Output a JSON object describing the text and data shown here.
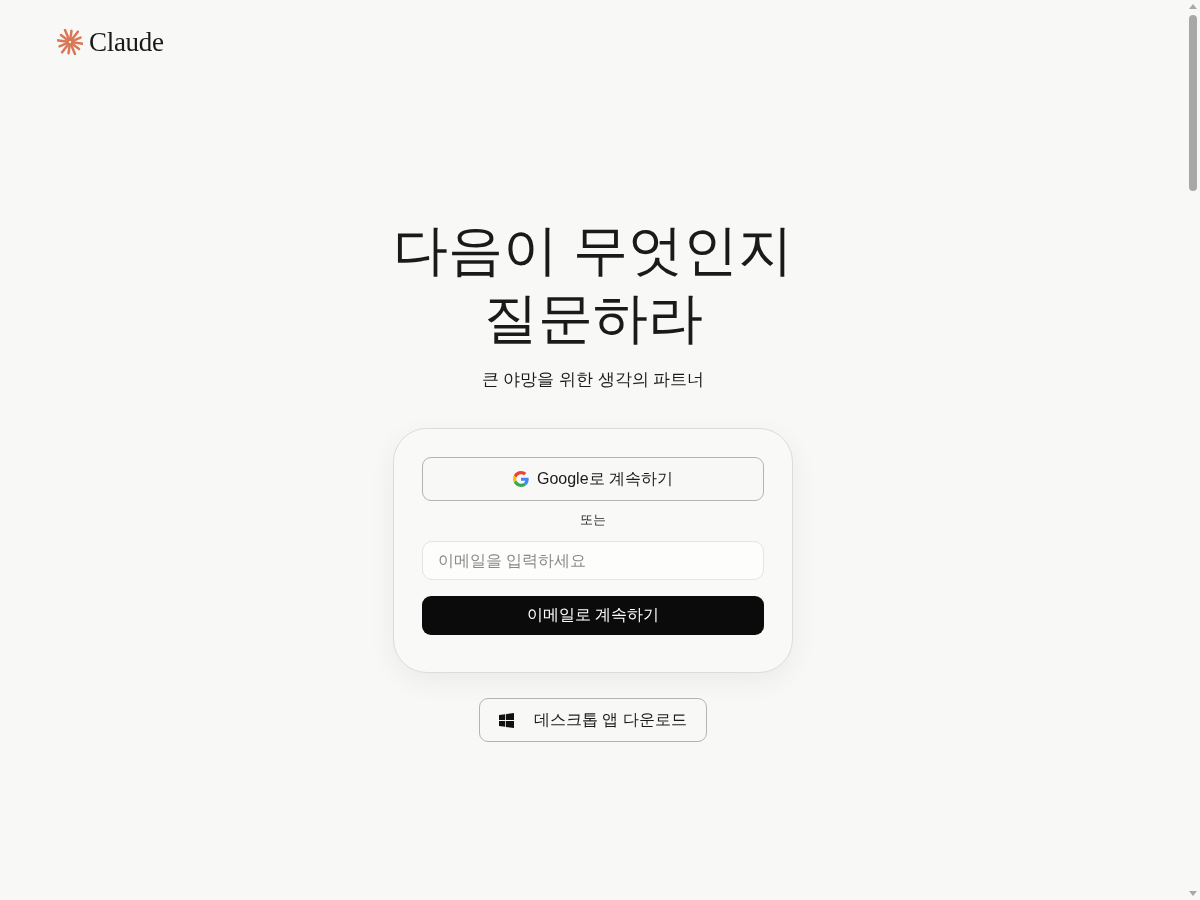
{
  "header": {
    "logo_text": "Claude"
  },
  "hero": {
    "title_lines": [
      "다음이 무엇인지",
      "질문하라"
    ],
    "subtitle": "큰 야망을 위한 생각의 파트너"
  },
  "login_card": {
    "google_button": {
      "label": "Google로 계속하기"
    },
    "divider": "또는",
    "email_field": {
      "placeholder": "이메일을 입력하세요"
    },
    "email_button": {
      "label": "이메일로 계속하기"
    }
  },
  "download_button": {
    "label": "데스크톱 앱 다운로드"
  }
}
